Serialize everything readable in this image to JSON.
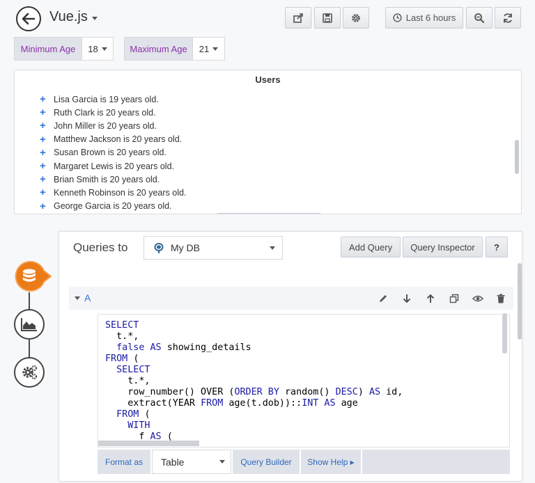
{
  "header": {
    "title": "Vue.js",
    "time_range": "Last 6 hours"
  },
  "variables": [
    {
      "label": "Minimum Age",
      "value": "18"
    },
    {
      "label": "Maximum Age",
      "value": "21"
    }
  ],
  "users_panel": {
    "title": "Users",
    "rows": [
      "Lisa Garcia is 19 years old.",
      "Ruth Clark is 20 years old.",
      "John Miller is 20 years old.",
      "Matthew Jackson is 20 years old.",
      "Susan Brown is 20 years old.",
      "Margaret Lewis is 20 years old.",
      "Brian Smith is 20 years old.",
      "Kenneth Robinson is 20 years old.",
      "George Garcia is 20 years old."
    ]
  },
  "editor": {
    "queries_to": "Queries to",
    "datasource": "My DB",
    "add_query": "Add Query",
    "query_inspector": "Query Inspector",
    "help": "?",
    "ref_id": "A",
    "format_as_label": "Format as",
    "format_as_value": "Table",
    "query_builder": "Query Builder",
    "show_help": "Show Help ▸"
  },
  "colors": {
    "accent": "#3274d9",
    "variable_label": "#8b32a8",
    "datasource_active": "#eb7b18",
    "sql_keyword": "#1a1aa6"
  }
}
